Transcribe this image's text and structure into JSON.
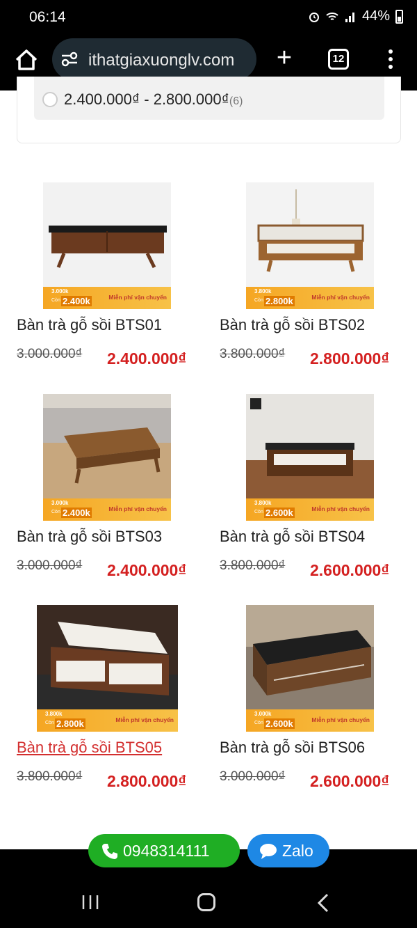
{
  "status_bar": {
    "time": "06:14",
    "battery": "44%"
  },
  "browser": {
    "url": "ithatgiaxuonglv.com",
    "plus": "+",
    "tab_count": "12"
  },
  "filter": {
    "option_label": "2.400.000₫ - 2.800.000₫",
    "option_count": "(6)"
  },
  "products": [
    {
      "name": "Bàn trà gỗ sồi BTS01",
      "price_old": "3.000.000₫",
      "price_new": "2.400.000₫",
      "banner_old": "3.000k",
      "banner_new": "2.400k",
      "banner_can": "Còn",
      "banner_free": "Miễn phí vận chuyển"
    },
    {
      "name": "Bàn trà gỗ sồi BTS02",
      "price_old": "3.800.000₫",
      "price_new": "2.800.000₫",
      "banner_old": "3.800k",
      "banner_new": "2.800k",
      "banner_can": "Còn",
      "banner_free": "Miễn phí vận chuyển"
    },
    {
      "name": "Bàn trà gỗ sồi BTS03",
      "price_old": "3.000.000₫",
      "price_new": "2.400.000₫",
      "banner_old": "3.000k",
      "banner_new": "2.400k",
      "banner_can": "Còn",
      "banner_free": "Miễn phí vận chuyển"
    },
    {
      "name": "Bàn trà gỗ sồi BTS04",
      "price_old": "3.800.000₫",
      "price_new": "2.600.000₫",
      "banner_old": "3.800k",
      "banner_new": "2.600k",
      "banner_can": "Còn",
      "banner_free": "Miễn phí vận chuyển"
    },
    {
      "name": "Bàn trà gỗ sồi BTS05",
      "price_old": "3.800.000₫",
      "price_new": "2.800.000₫",
      "banner_old": "3.800k",
      "banner_new": "2.800k",
      "banner_can": "Còn",
      "banner_free": "Miễn phí vận chuyển"
    },
    {
      "name": "Bàn trà gỗ sồi BTS06",
      "price_old": "3.000.000₫",
      "price_new": "2.600.000₫",
      "banner_old": "3.000k",
      "banner_new": "2.600k",
      "banner_can": "Còn",
      "banner_free": "Miễn phí vận chuyển"
    }
  ],
  "contact": {
    "phone": "0948314111",
    "zalo": "Zalo"
  },
  "colors": {
    "price_red": "#d42020",
    "call_green": "#1fae24",
    "zalo_blue": "#1e88e5",
    "banner_orange": "#f5a623"
  }
}
